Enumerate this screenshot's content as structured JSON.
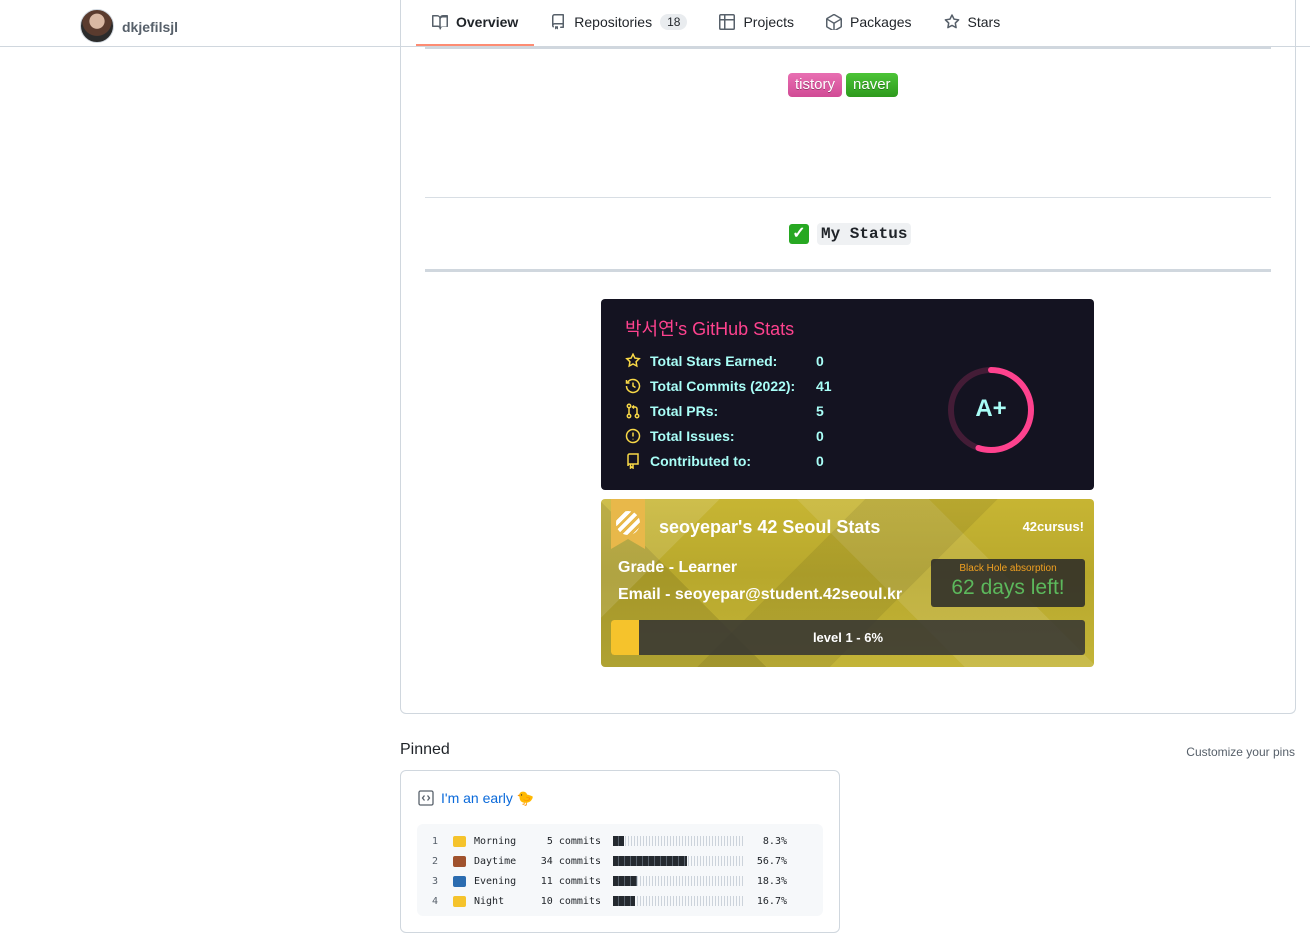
{
  "user": {
    "username": "dkjefilsjl"
  },
  "tabs": [
    {
      "label": "Overview",
      "icon": "book-icon",
      "active": true
    },
    {
      "label": "Repositories",
      "icon": "repo-icon",
      "count": "18"
    },
    {
      "label": "Projects",
      "icon": "table-icon"
    },
    {
      "label": "Packages",
      "icon": "package-icon"
    },
    {
      "label": "Stars",
      "icon": "star-icon"
    }
  ],
  "readme": {
    "badges": [
      {
        "label": "tistory",
        "color": "#d14b95"
      },
      {
        "label": "naver",
        "color": "#2e9a1d"
      }
    ],
    "status_check": "✅",
    "status_heading": "My Status",
    "github_stats": {
      "title_name": "박서연",
      "title_suffix": "'s GitHub Stats",
      "rows": [
        {
          "label": "Total Stars Earned:",
          "value": "0",
          "icon": "star-icon"
        },
        {
          "label": "Total Commits (2022):",
          "value": "41",
          "icon": "history-icon"
        },
        {
          "label": "Total PRs:",
          "value": "5",
          "icon": "pull-request-icon"
        },
        {
          "label": "Total Issues:",
          "value": "0",
          "icon": "issue-icon"
        },
        {
          "label": "Contributed to:",
          "value": "0",
          "icon": "repo-icon"
        }
      ],
      "rank": "A+",
      "rank_progress": 0.55,
      "colors": {
        "title": "#fe428e",
        "text": "#a9fef7",
        "icon": "#f8d847",
        "bg": "#141321"
      }
    },
    "seoul_stats": {
      "title": "seoyepar's 42 Seoul Stats",
      "cursus": "42cursus!",
      "grade": "Grade - Learner",
      "email": "Email - seoyepar@student.42seoul.kr",
      "blackhole_label": "Black Hole absorption",
      "blackhole_days": "62 days left!",
      "level_text": "level 1 - 6%",
      "level_progress": 0.06
    }
  },
  "pinned": {
    "title": "Pinned",
    "customize": "Customize your pins",
    "gist_title": "I'm an early 🐤",
    "rows": [
      {
        "num": "1",
        "emoji": "🌞",
        "name": "Morning",
        "commits": "5 commits",
        "percent": "8.3%",
        "fraction": 0.083,
        "emoji_color": "#f5c32c"
      },
      {
        "num": "2",
        "emoji": "🌆",
        "name": "Daytime",
        "commits": "34 commits",
        "percent": "56.7%",
        "fraction": 0.567,
        "emoji_color": "#a0522d"
      },
      {
        "num": "3",
        "emoji": "🌃",
        "name": "Evening",
        "commits": "11 commits",
        "percent": "18.3%",
        "fraction": 0.183,
        "emoji_color": "#2b6cb0"
      },
      {
        "num": "4",
        "emoji": "🌙",
        "name": "Night",
        "commits": "10 commits",
        "percent": "16.7%",
        "fraction": 0.167,
        "emoji_color": "#f5c32c"
      }
    ]
  }
}
